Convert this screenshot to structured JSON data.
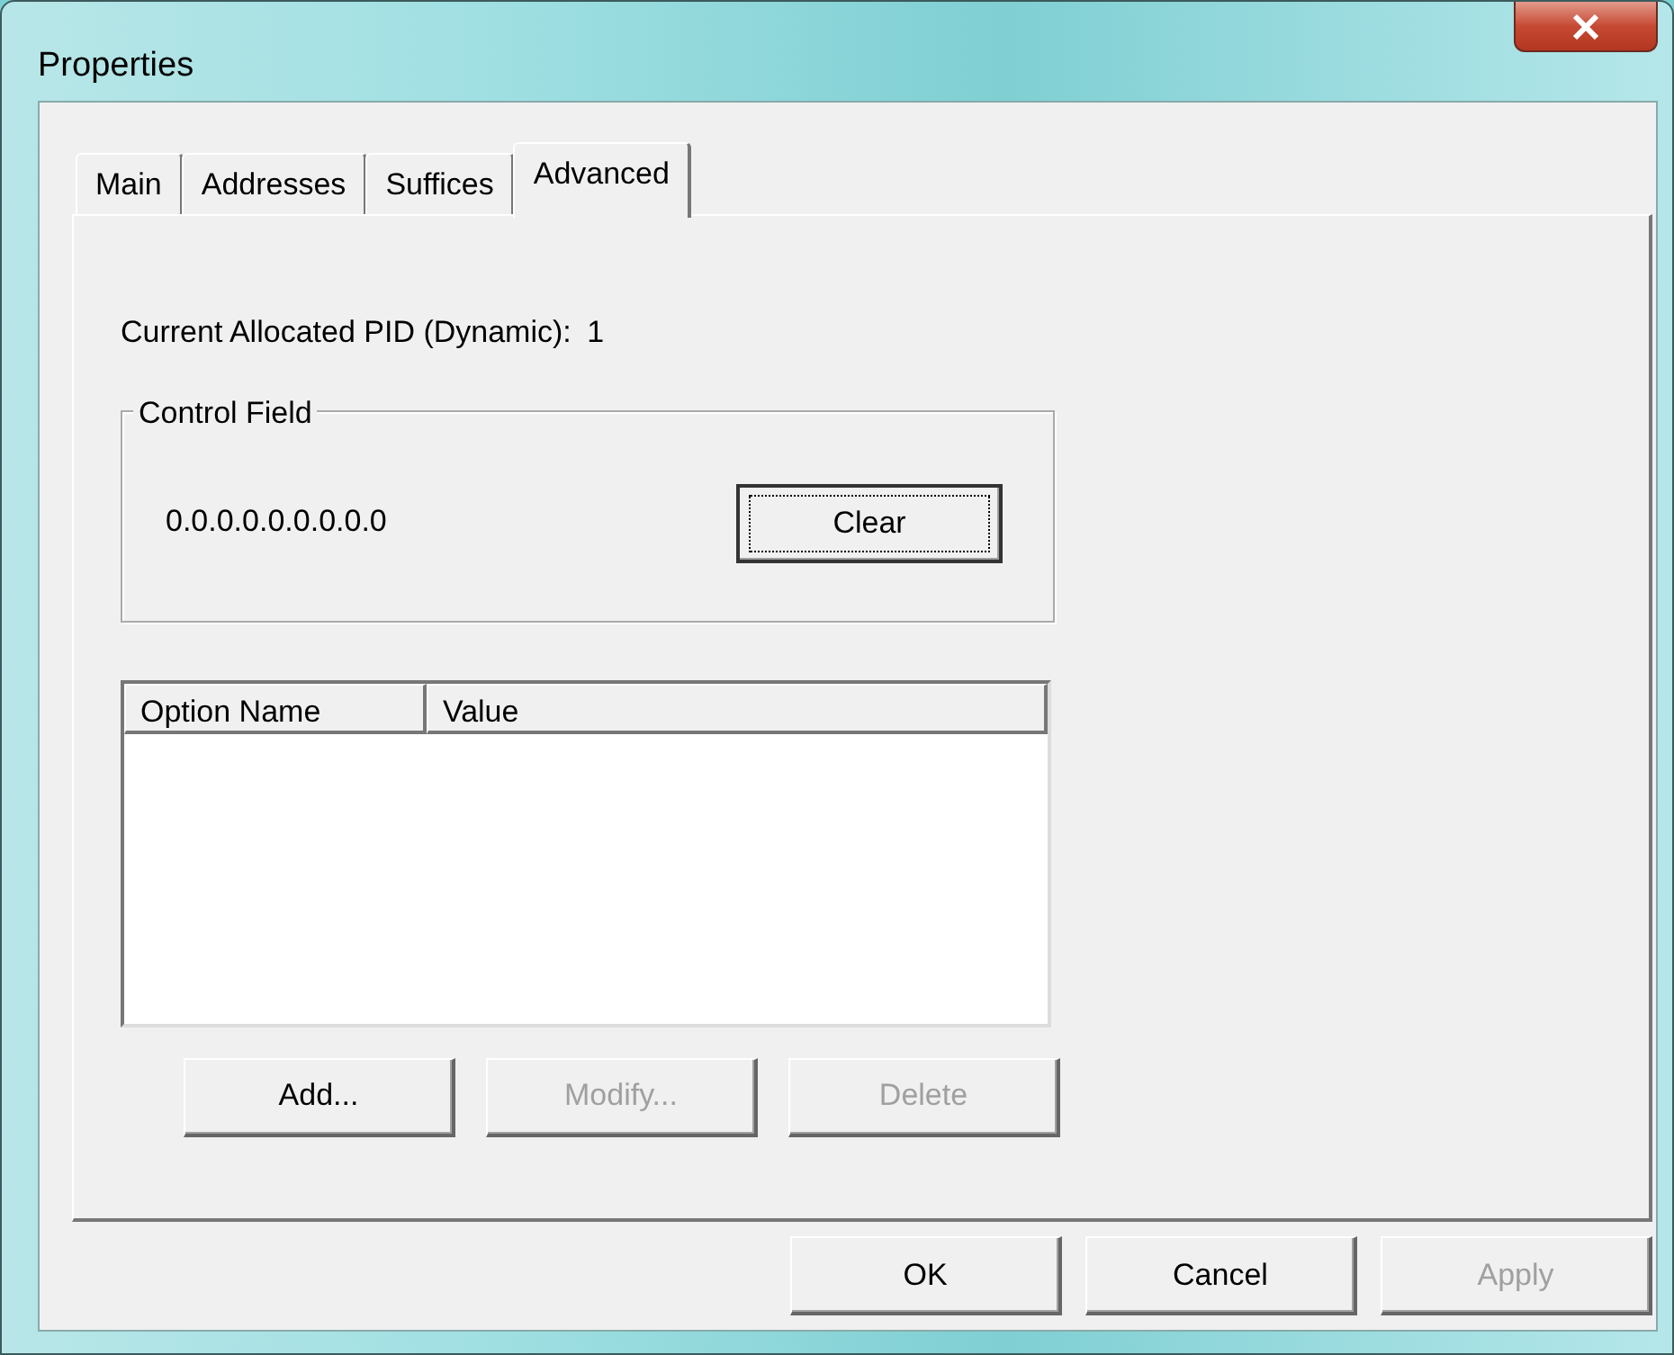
{
  "window": {
    "title": "Properties"
  },
  "tabs": [
    {
      "label": "Main",
      "selected": false
    },
    {
      "label": "Addresses",
      "selected": false
    },
    {
      "label": "Suffices",
      "selected": false
    },
    {
      "label": "Advanced",
      "selected": true
    }
  ],
  "pid": {
    "label": "Current Allocated PID (Dynamic):",
    "value": "1"
  },
  "control_field": {
    "title": "Control Field",
    "value": "0.0.0.0.0.0.0.0.0",
    "button": {
      "label": "Clear",
      "focused": true
    }
  },
  "options_list": {
    "columns": [
      "Option Name",
      "Value"
    ]
  },
  "list_buttons": [
    {
      "label": "Add...",
      "disabled": false
    },
    {
      "label": "Modify...",
      "disabled": true
    },
    {
      "label": "Delete",
      "disabled": true
    }
  ],
  "dialog_buttons": [
    {
      "label": "OK",
      "disabled": false
    },
    {
      "label": "Cancel",
      "disabled": false
    },
    {
      "label": "Apply",
      "disabled": true
    }
  ]
}
